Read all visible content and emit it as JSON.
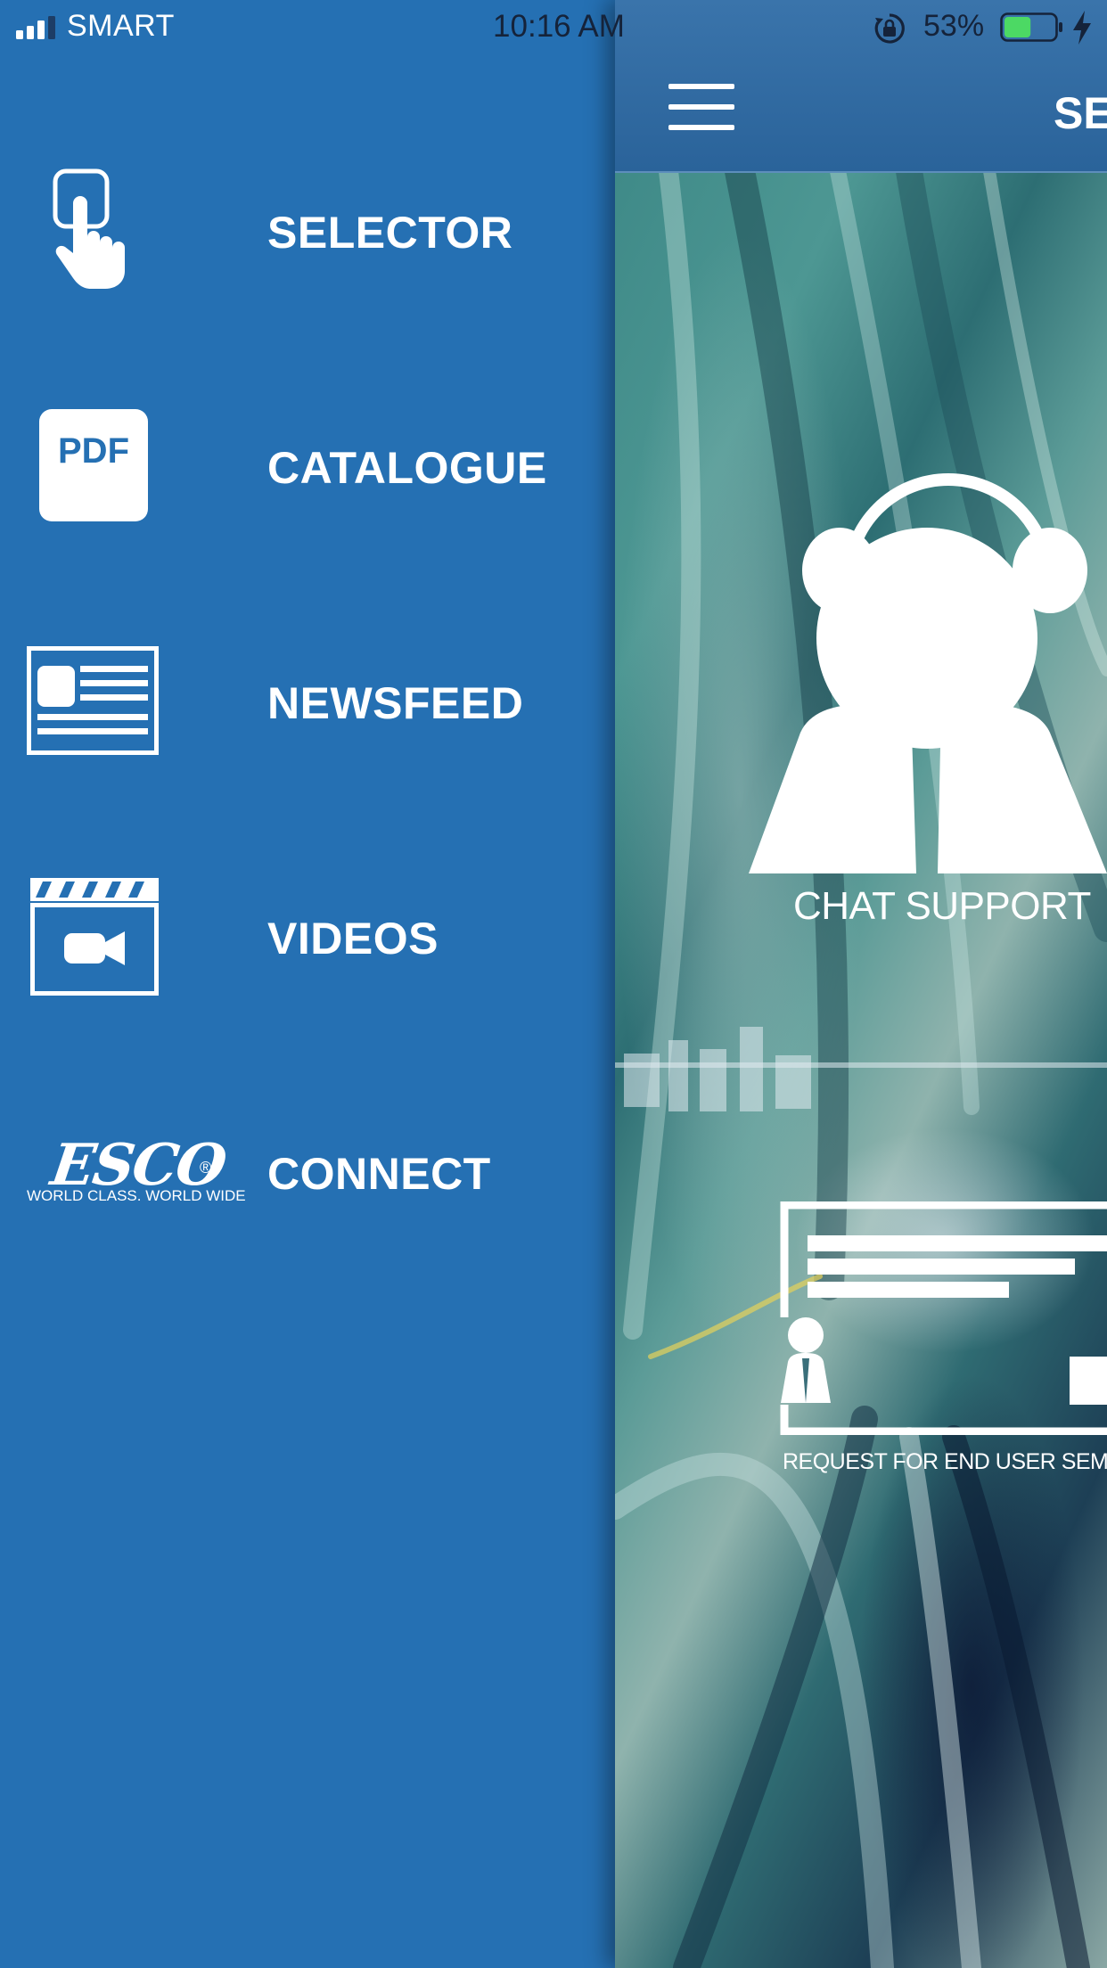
{
  "status_bar": {
    "carrier": "SMART",
    "time": "10:16 AM",
    "battery_percent": "53%",
    "battery_level": 0.53,
    "battery_color": "#4cd964"
  },
  "side_menu": {
    "background_color": "#2570b3",
    "items": [
      {
        "label": "SELECTOR",
        "icon": "touch-hand-icon"
      },
      {
        "label": "CATALOGUE",
        "icon": "pdf-icon",
        "icon_text": "PDF"
      },
      {
        "label": "NEWSFEED",
        "icon": "newspaper-icon"
      },
      {
        "label": "VIDEOS",
        "icon": "video-clapperboard-icon"
      },
      {
        "label": "CONNECT",
        "icon": "esco-logo"
      }
    ],
    "logo": {
      "brand": "ESCO",
      "registered": "®",
      "tagline": "WORLD CLASS. WORLD WIDE"
    }
  },
  "main": {
    "nav_title": "SE",
    "chat_support_label": "CHAT SUPPORT",
    "seminar_label": "REQUEST FOR END USER SEM"
  }
}
